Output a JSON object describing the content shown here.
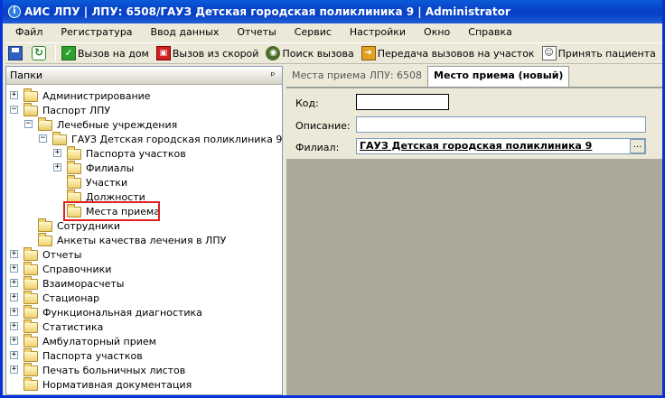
{
  "window": {
    "title": "АИС ЛПУ | ЛПУ: 6508/ГАУЗ Детская городская поликлиника 9 | Administrator"
  },
  "menu": [
    "Файл",
    "Регистратура",
    "Ввод данных",
    "Отчеты",
    "Сервис",
    "Настройки",
    "Окно",
    "Справка"
  ],
  "toolbar": {
    "call_home": "Вызов на дом",
    "call_ambulance": "Вызов из скорой",
    "search_call": "Поиск вызова",
    "transfer_calls": "Передача вызовов на участок",
    "accept_patient": "Принять пациента"
  },
  "left_panel": {
    "title": "Папки",
    "pin": "ᵖ"
  },
  "tree": [
    {
      "label": "Администрирование",
      "level": 0,
      "expander": "+"
    },
    {
      "label": "Паспорт ЛПУ",
      "level": 0,
      "expander": "−"
    },
    {
      "label": "Лечебные учреждения",
      "level": 1,
      "expander": "−"
    },
    {
      "label": "ГАУЗ Детская городская поликлиника 9",
      "level": 2,
      "expander": "−"
    },
    {
      "label": "Паспорта участков",
      "level": 3,
      "expander": "+"
    },
    {
      "label": "Филиалы",
      "level": 3,
      "expander": "+"
    },
    {
      "label": "Участки",
      "level": 3,
      "expander": ""
    },
    {
      "label": "Должности",
      "level": 3,
      "expander": ""
    },
    {
      "label": "Места приема",
      "level": 3,
      "expander": "",
      "selected": true
    },
    {
      "label": "Сотрудники",
      "level": 1,
      "expander": ""
    },
    {
      "label": "Анкеты качества лечения в ЛПУ",
      "level": 1,
      "expander": ""
    },
    {
      "label": "Отчеты",
      "level": 0,
      "expander": "+"
    },
    {
      "label": "Справочники",
      "level": 0,
      "expander": "+"
    },
    {
      "label": "Взаиморасчеты",
      "level": 0,
      "expander": "+"
    },
    {
      "label": "Стационар",
      "level": 0,
      "expander": "+"
    },
    {
      "label": "Функциональная диагностика",
      "level": 0,
      "expander": "+"
    },
    {
      "label": "Статистика",
      "level": 0,
      "expander": "+"
    },
    {
      "label": "Амбулаторный прием",
      "level": 0,
      "expander": "+"
    },
    {
      "label": "Паспорта участков",
      "level": 0,
      "expander": "+"
    },
    {
      "label": "Печать больничных листов",
      "level": 0,
      "expander": "+"
    },
    {
      "label": "Нормативная документация",
      "level": 0,
      "expander": ""
    }
  ],
  "tabs": [
    {
      "label": "Места приема ЛПУ: 6508",
      "active": false
    },
    {
      "label": "Место приема (новый)",
      "active": true
    }
  ],
  "form": {
    "code_label": "Код:",
    "code_value": "",
    "description_label": "Описание:",
    "description_value": "",
    "branch_label": "Филиал:",
    "branch_value": "ГАУЗ Детская городская поликлиника 9",
    "ellipsis": "..."
  }
}
